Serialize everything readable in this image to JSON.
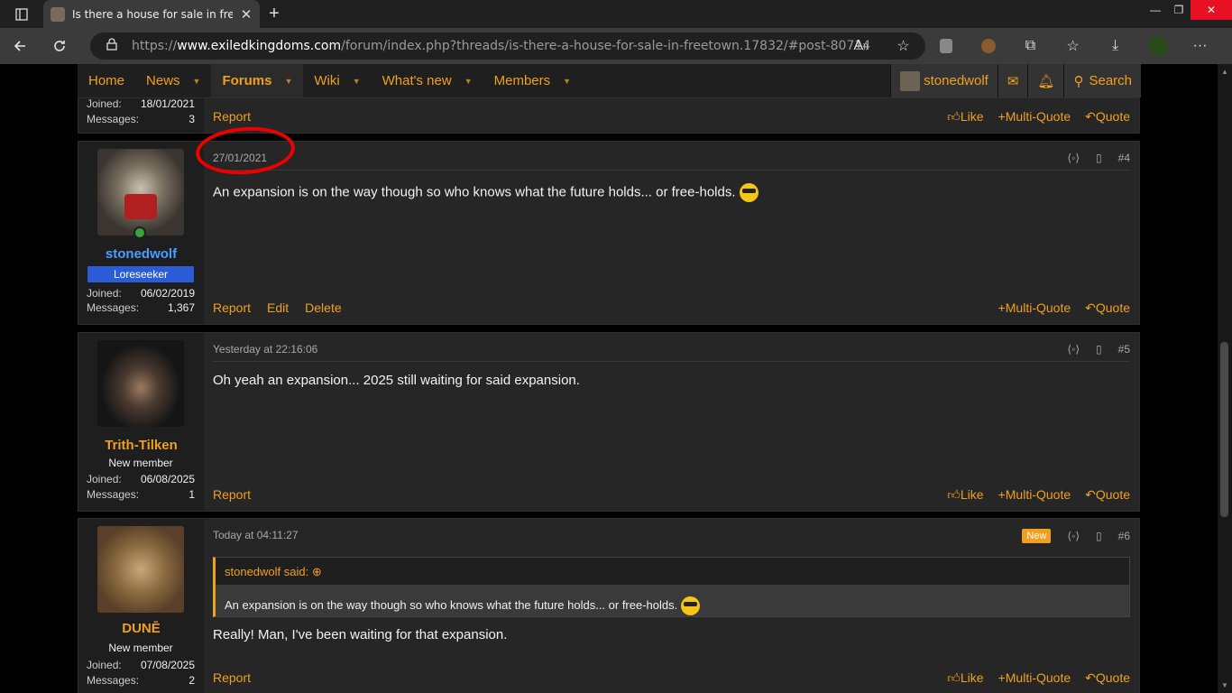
{
  "browser": {
    "tab_title": "Is there a house for sale in freeto",
    "url_prefix": "https://",
    "url_domain": "www.exiledkingdoms.com",
    "url_path": "/forum/index.php?threads/is-there-a-house-for-sale-in-freetown.17832/#post-80714"
  },
  "nav": {
    "home": "Home",
    "news": "News",
    "forums": "Forums",
    "wiki": "Wiki",
    "whats_new": "What's new",
    "members": "Members",
    "username": "stonedwolf",
    "search": "Search"
  },
  "post3": {
    "joined_label": "Joined:",
    "joined": "18/01/2021",
    "messages_label": "Messages:",
    "messages": "3",
    "report": "Report",
    "like": "Like",
    "multiquote": "Multi-Quote",
    "quote": "Quote"
  },
  "post4": {
    "username": "stonedwolf",
    "title": "Loreseeker",
    "joined_label": "Joined:",
    "joined": "06/02/2019",
    "messages_label": "Messages:",
    "messages": "1,367",
    "date": "27/01/2021",
    "number": "#4",
    "text": "An expansion is on the way though so who knows what the future holds... or free-holds.",
    "report": "Report",
    "edit": "Edit",
    "delete": "Delete",
    "multiquote": "Multi-Quote",
    "quote": "Quote"
  },
  "post5": {
    "username": "Trith-Tilken",
    "title": "New member",
    "joined_label": "Joined:",
    "joined": "06/08/2025",
    "messages_label": "Messages:",
    "messages": "1",
    "date": "Yesterday at 22:16:06",
    "number": "#5",
    "text": "Oh yeah an expansion... 2025 still waiting for said expansion.",
    "report": "Report",
    "like": "Like",
    "multiquote": "Multi-Quote",
    "quote": "Quote"
  },
  "post6": {
    "username": "DUNĒ",
    "title": "New member",
    "joined_label": "Joined:",
    "joined": "07/08/2025",
    "messages_label": "Messages:",
    "messages": "2",
    "date": "Today at 04:11:27",
    "badge": "New",
    "number": "#6",
    "quote_author": "stonedwolf said:",
    "quote_text": "An expansion is on the way though so who knows what the future holds... or free-holds.",
    "text": "Really! Man, I've been waiting for that expansion.",
    "report": "Report",
    "like": "Like",
    "multiquote": "Multi-Quote",
    "quote": "Quote"
  },
  "colors": {
    "accent": "#f0a020",
    "username_blue": "#4a9eff",
    "annotation_red": "#ee0000"
  }
}
